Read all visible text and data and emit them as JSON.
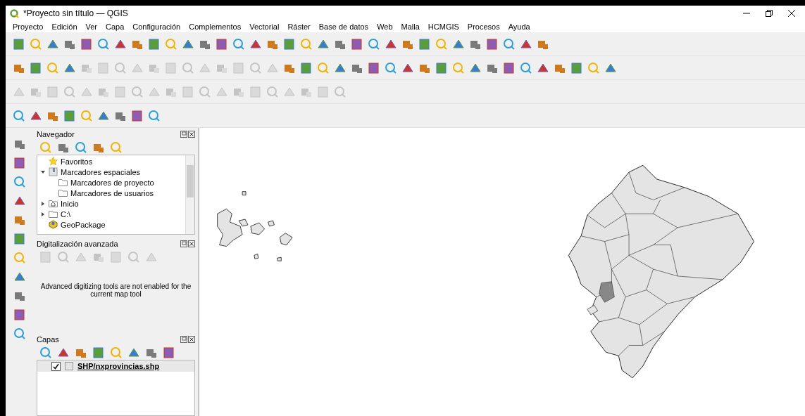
{
  "window": {
    "title": "*Proyecto sin título — QGIS"
  },
  "menu": [
    "Proyecto",
    "Edición",
    "Ver",
    "Capa",
    "Configuración",
    "Complementos",
    "Vectorial",
    "Ráster",
    "Base de datos",
    "Web",
    "Malla",
    "HCMGIS",
    "Procesos",
    "Ayuda"
  ],
  "navigator": {
    "title": "Navegador",
    "tree": [
      {
        "label": "Favoritos",
        "kind": "favorites"
      },
      {
        "label": "Marcadores espaciales",
        "kind": "bookmarks",
        "expanded": true,
        "children": [
          {
            "label": "Marcadores de proyecto",
            "kind": "folder"
          },
          {
            "label": "Marcadores de usuarios",
            "kind": "folder"
          }
        ]
      },
      {
        "label": "Inicio",
        "kind": "home",
        "expanded": false
      },
      {
        "label": "C:\\",
        "kind": "folder",
        "expanded": false
      },
      {
        "label": "GeoPackage",
        "kind": "geopackage"
      }
    ]
  },
  "advanced_digitizing": {
    "title": "Digitalización avanzada",
    "message": "Advanced digitizing tools are not enabled for the current map tool"
  },
  "layers": {
    "title": "Capas",
    "items": [
      {
        "name": "SHP/nxprovincias.shp",
        "checked": true,
        "selected": true
      }
    ]
  }
}
